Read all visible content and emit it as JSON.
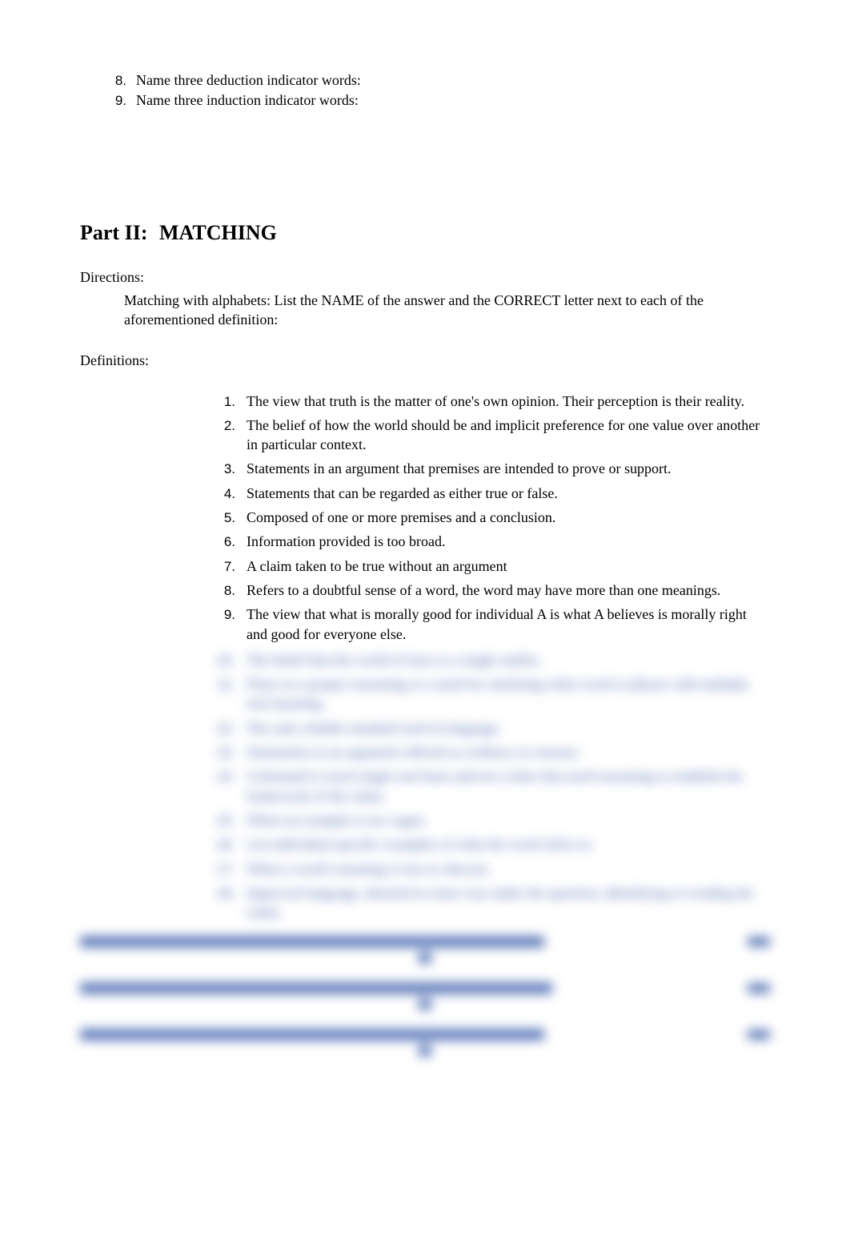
{
  "top_list": {
    "items": [
      {
        "num": "8.",
        "text": "Name three deduction indicator words:"
      },
      {
        "num": "9.",
        "text": "Name three induction indicator words:"
      }
    ]
  },
  "part_heading": {
    "label": "Part II:",
    "title": "MATCHING"
  },
  "directions": {
    "label": "Directions:",
    "body": "Matching with alphabets:  List the NAME of the answer and the CORRECT letter next to each of the aforementioned definition:"
  },
  "definitions": {
    "label": "Definitions:",
    "items": [
      {
        "num": "1.",
        "text": "The view that truth is the matter of one's own opinion.  Their perception is their reality."
      },
      {
        "num": "2.",
        "text": "The belief of how the world should be and implicit preference for one value over another in particular context."
      },
      {
        "num": "3.",
        "text": "Statements in an argument that premises are intended to prove or support."
      },
      {
        "num": "4.",
        "text": "Statements that can be regarded as either true or false."
      },
      {
        "num": "5.",
        "text": "Composed of one or more premises and a conclusion."
      },
      {
        "num": "6.",
        "text": "Information provided is too broad."
      },
      {
        "num": "7.",
        "text": "A claim taken to be true without an argument"
      },
      {
        "num": "8.",
        "text": "Refers to a doubtful sense of a word, the word may have more than one meanings."
      },
      {
        "num": "9.",
        "text": "The view that what is morally good for individual A is what A believes is morally right and good for everyone else."
      }
    ]
  },
  "blurred_items": [
    {
      "num": "10.",
      "text": "The belief that the world of facts is a single unifier."
    },
    {
      "num": "11.",
      "text": "Flaws in a proper reasoning or a need for clarifying when word or phrase with multiple real meaning."
    },
    {
      "num": "12.",
      "text": "The only reliable standard used in language."
    },
    {
      "num": "13.",
      "text": "Statements in an argument offered as evidence or reasons."
    },
    {
      "num": "14.",
      "text": "A demand to reach  single  real basis and not a false that used reasoning to establish the framework of the claim."
    },
    {
      "num": "15.",
      "text": "When an example is too vague."
    },
    {
      "num": "16.",
      "text": "List individual specific examples of what the word refers to."
    },
    {
      "num": "17.",
      "text": "When a word's meaning is lost or obscure."
    },
    {
      "num": "18.",
      "text": "Improved language, denoted in some way under the question, identifying or evading the claim."
    }
  ],
  "blurred_bottom_widths": [
    580,
    590,
    580
  ]
}
